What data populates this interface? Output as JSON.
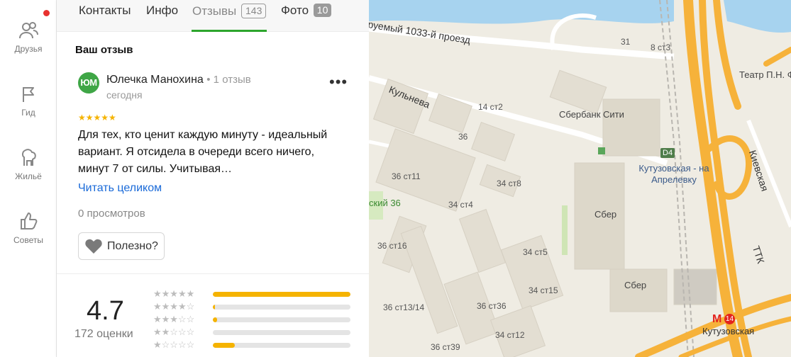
{
  "sidebar": {
    "items": [
      {
        "label": "Друзья",
        "icon": "friends-icon"
      },
      {
        "label": "Гид",
        "icon": "flag-icon"
      },
      {
        "label": "Жильё",
        "icon": "housing-icon"
      },
      {
        "label": "Советы",
        "icon": "thumbs-up-icon"
      }
    ]
  },
  "tabs": [
    {
      "label": "Контакты"
    },
    {
      "label": "Инфо"
    },
    {
      "label": "Отзывы",
      "count": "143"
    },
    {
      "label": "Фото",
      "count": "10"
    }
  ],
  "review": {
    "section_title": "Ваш отзыв",
    "avatar_initials": "ЮМ",
    "author": "Юлечка Манохина",
    "author_meta": "• 1 отзыв",
    "date": "сегодня",
    "more": "•••",
    "stars": "★★★★★",
    "text": "Для тех, кто ценит каждую минуту - идеальный вариант. Я отсидела в очереди всего ничего, минут 7 от силы. Учитывая…",
    "read_more": "Читать целиком",
    "views": "0 просмотров",
    "useful_label": "Полезно?"
  },
  "rating": {
    "value": "4.7",
    "count": "172 оценки",
    "distribution": [
      {
        "stars": "★★★★★",
        "fraction": 1.0
      },
      {
        "stars": "★★★★",
        "fraction": 0.01
      },
      {
        "stars": "★★★",
        "fraction": 0.03
      },
      {
        "stars": "★★",
        "fraction": 0.0
      },
      {
        "stars": "★",
        "fraction": 0.16
      }
    ]
  },
  "map": {
    "labels": {
      "proezd": "руемый 1033-й проезд",
      "kulneva": "Кульнева",
      "kievskaya": "Киевская",
      "ttk": "ТТК",
      "teatr": "Театр П.Н. Фом",
      "sberbank_city": "Сбербанк Сити",
      "kutuzovskaya_aprel": "Кутузовская - на Апрелевку",
      "d4": "D4",
      "sber1": "Сбер",
      "sber2": "Сбер",
      "metro_name": "Кутузовская",
      "metro_m": "М",
      "metro_num": "14",
      "skiy36": "ский 36",
      "b31": "31",
      "b8st3": "8 ст3",
      "b14st2": "14 ст2",
      "b36": "36",
      "b36st11": "36 ст11",
      "b34st8": "34 ст8",
      "b34st4": "34 ст4",
      "b36st16": "36 ст16",
      "b34st5": "34 ст5",
      "b34st15": "34 ст15",
      "b36st13_14": "36 ст13/14",
      "b36st36": "36 ст36",
      "b34st12": "34 ст12",
      "b36st39": "36 ст39"
    }
  },
  "colors": {
    "accent_green": "#2da52d",
    "star_yellow": "#f5b300",
    "link_blue": "#1a6ad8",
    "notify_red": "#e8312f",
    "road_orange": "#f6b23a",
    "water": "#a7d3ef"
  }
}
